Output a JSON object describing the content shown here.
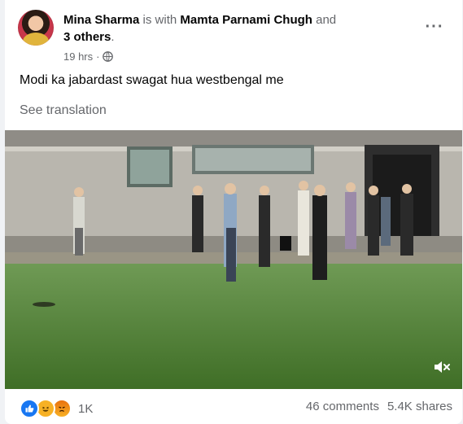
{
  "post": {
    "author": "Mina Sharma",
    "with_text": "is with",
    "tagged": "Mamta Parnami Chugh",
    "and_text": "and",
    "others": "3 others",
    "period": ".",
    "time": "19 hrs",
    "separator": "·",
    "text": "Modi ka jabardast swagat hua westbengal me",
    "see_translation": "See translation",
    "more_icon": "more-options-icon",
    "privacy_icon": "globe-icon"
  },
  "video": {
    "mute_icon": "speaker-muted-icon"
  },
  "footer": {
    "reactions": [
      "like",
      "haha",
      "angry"
    ],
    "reaction_count": "1K",
    "comments": "46 comments",
    "shares": "5.4K shares"
  },
  "colors": {
    "facebook_blue": "#1877f2",
    "secondary_text": "#65676b",
    "grass": "#4d7a32"
  }
}
